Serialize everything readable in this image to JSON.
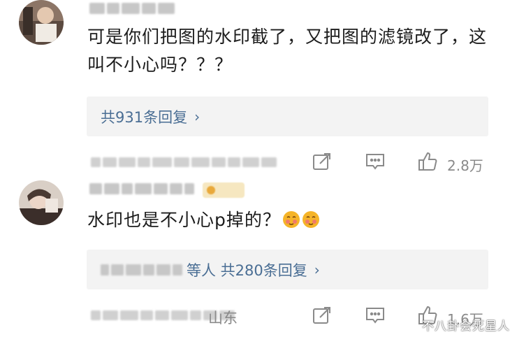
{
  "comments": [
    {
      "text": "可是你们把图的水印截了，又把图的滤镜改了，这叫不小心吗？？？",
      "reply_summary": "共931条回复",
      "like_count": "2.8万",
      "location": ""
    },
    {
      "text": "水印也是不小心p掉的？",
      "reply_summary": "等人 共280条回复",
      "like_count": "1.6万",
      "location": "山东"
    }
  ],
  "icons": {
    "share": "share-icon",
    "comment": "comment-icon",
    "like": "thumbs-up-icon",
    "chevron": "chevron-right-icon",
    "emoji": "blushing-face-icon"
  },
  "watermark": "不八卦会死星人",
  "colors": {
    "link": "#4a6e94",
    "meta": "#8a8a8a",
    "reply_bg": "#f3f3f3"
  }
}
